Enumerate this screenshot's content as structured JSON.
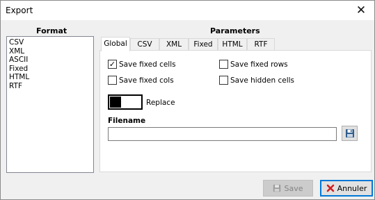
{
  "window": {
    "title": "Export"
  },
  "format": {
    "heading": "Format",
    "items": [
      "CSV",
      "XML",
      "ASCII",
      "Fixed",
      "HTML",
      "RTF"
    ]
  },
  "parameters": {
    "heading": "Parameters",
    "tabs": [
      "Global",
      "CSV",
      "XML",
      "Fixed",
      "HTML",
      "RTF"
    ],
    "active_tab": "Global",
    "checkboxes": [
      {
        "label": "Save fixed cells",
        "checked": true
      },
      {
        "label": "Save fixed cols",
        "checked": false
      },
      {
        "label": "Save fixed rows",
        "checked": false
      },
      {
        "label": "Save hidden cells",
        "checked": false
      }
    ],
    "replace_label": "Replace",
    "filename_label": "Filename",
    "filename_value": ""
  },
  "buttons": {
    "save_label": "Save",
    "cancel_label": "Annuler"
  },
  "colors": {
    "focus_border": "#0078d7",
    "cancel_icon": "#d21f1f",
    "disk_icon": "#2f5d8c"
  }
}
